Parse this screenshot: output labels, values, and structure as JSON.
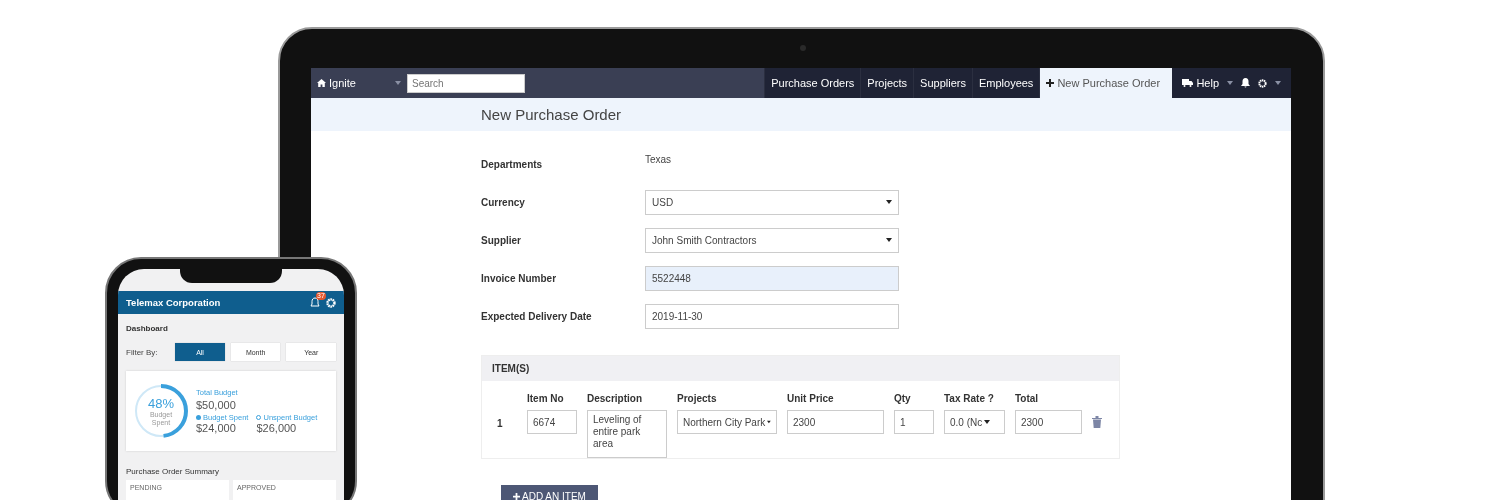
{
  "laptop": {
    "navbar": {
      "brand": "Ignite",
      "search": {
        "placeholder": "Search"
      },
      "tabs": [
        {
          "label": "Purchase Orders",
          "selected": false,
          "kind": "link"
        },
        {
          "label": "Projects",
          "selected": false,
          "kind": "link"
        },
        {
          "label": "Suppliers",
          "selected": false,
          "kind": "link"
        },
        {
          "label": "Employees",
          "selected": false,
          "kind": "link"
        },
        {
          "label": "New Purchase Order",
          "selected": true,
          "kind": "new"
        }
      ],
      "help": "Help"
    },
    "page_title": "New Purchase Order",
    "form": [
      {
        "label": "Departments",
        "value": "Texas",
        "kind": "text"
      },
      {
        "label": "Currency",
        "value": "USD",
        "kind": "select"
      },
      {
        "label": "Supplier",
        "value": "John Smith Contractors",
        "kind": "select"
      },
      {
        "label": "Invoice Number",
        "value": "5522448",
        "kind": "input",
        "focused": true
      },
      {
        "label": "Expected Delivery Date",
        "value": "2019-11-30",
        "kind": "input",
        "focused": false
      }
    ],
    "items": {
      "title": "ITEM(S)",
      "columns": [
        "Item No",
        "Description",
        "Projects",
        "Unit Price",
        "Qty",
        "Tax Rate ?",
        "Total"
      ],
      "rows": [
        {
          "number": "1",
          "cells": [
            {
              "value": "6674",
              "kind": "input"
            },
            {
              "value": "Leveling of entire park area",
              "kind": "textarea"
            },
            {
              "value": "Northern City Park",
              "kind": "select"
            },
            {
              "value": "2300",
              "kind": "input"
            },
            {
              "value": "1",
              "kind": "input"
            },
            {
              "value": "0.0 (Nc",
              "kind": "select"
            },
            {
              "value": "2300",
              "kind": "input"
            }
          ]
        }
      ],
      "add_button": "ADD AN ITEM"
    }
  },
  "phone": {
    "title": "Telemax Corporation",
    "badge": "37",
    "section": "Dashboard",
    "filter_label": "Filter By:",
    "filters": [
      {
        "label": "All",
        "selected": true
      },
      {
        "label": "Month",
        "selected": false
      },
      {
        "label": "Year",
        "selected": false
      }
    ],
    "budget": {
      "level": 0.48,
      "percent": "48%",
      "caption": "Budget Spent",
      "total_label": "Total Budget",
      "total": "$50,000",
      "spent_label": "Budget Spent",
      "spent": "$24,000",
      "unspent_label": "Unspent Budget",
      "unspent": "$26,000"
    },
    "summary_title": "Purchase Order Summary",
    "summary_cards": [
      "PENDING",
      "APPROVED"
    ]
  }
}
